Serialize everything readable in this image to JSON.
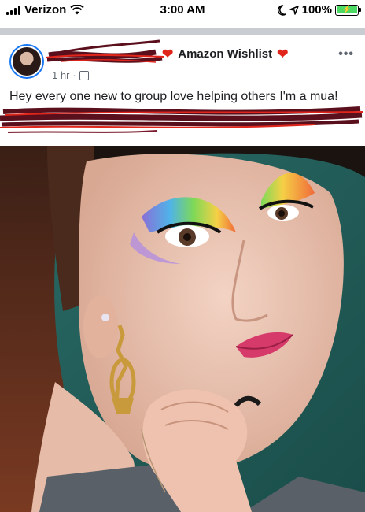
{
  "status_bar": {
    "carrier": "Verizon",
    "time": "3:00 AM",
    "battery": "100%"
  },
  "post": {
    "group_name": "Amazon Wishlist",
    "timestamp": "1 hr",
    "separator": "·",
    "more_label": "•••",
    "text": "Hey every one new to group love helping others I'm a mua!"
  },
  "icons": {
    "signal": "signal-bars-icon",
    "wifi": "wifi-icon",
    "moon": "moon-icon",
    "location": "location-arrow-icon",
    "battery": "battery-charging-icon",
    "heart": "red-heart-icon",
    "audience": "group-audience-icon",
    "more": "more-options-icon"
  },
  "colors": {
    "accent": "#1877f2",
    "heart": "#e0251b",
    "battery": "#4cd964",
    "scribble_dark": "#5a0f1c",
    "scribble_red": "#e0251b"
  }
}
